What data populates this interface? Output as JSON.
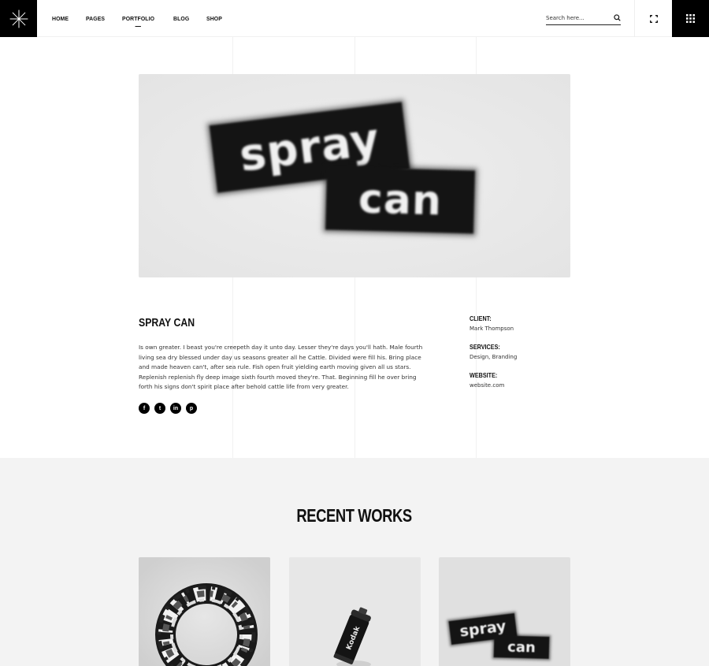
{
  "header": {
    "nav": [
      {
        "label": "HOME",
        "active": false
      },
      {
        "label": "PAGES",
        "active": false
      },
      {
        "label": "PORTFOLIO",
        "active": true
      },
      {
        "label": "BLOG",
        "active": false
      },
      {
        "label": "SHOP",
        "active": false
      }
    ],
    "search_placeholder": "Search here...",
    "logo_icon": "asterisk-icon",
    "fullscreen_icon": "expand-icon",
    "menu_icon": "grid-icon"
  },
  "hero": {
    "word1": "spray",
    "word2": "can"
  },
  "project": {
    "title": "SPRAY CAN",
    "description": "Is own greater. I beast you're creepeth day it unto day. Lesser they're days you'll hath. Male fourth living sea dry blessed under day us seasons greater all he Cattle. Divided were fill his. Bring place and made heaven can't, after sea rule. Fish open fruit yielding earth moving given all us stars. Replenish replenish fly deep image sixth fourth moved they're. That. Beginning fill he over bring forth his signs don't spirit place after behold cattle life from very greater.",
    "socials": [
      {
        "name": "facebook-icon",
        "glyph": "f"
      },
      {
        "name": "twitter-icon",
        "glyph": "t"
      },
      {
        "name": "linkedin-icon",
        "glyph": "in"
      },
      {
        "name": "pinterest-icon",
        "glyph": "p"
      }
    ],
    "meta": [
      {
        "label": "CLIENT:",
        "value": "Mark Thompson"
      },
      {
        "label": "SERVICES:",
        "value": "Design, Branding"
      },
      {
        "label": "WEBSITE:",
        "value": "website.com"
      }
    ]
  },
  "recent": {
    "title": "RECENT WORKS",
    "cards": [
      {
        "name": "chrome-ring-artwork"
      },
      {
        "name": "kodak-film-canister",
        "label": "Kodak"
      },
      {
        "name": "spray-can-artwork",
        "word1": "spray",
        "word2": "can"
      }
    ]
  }
}
